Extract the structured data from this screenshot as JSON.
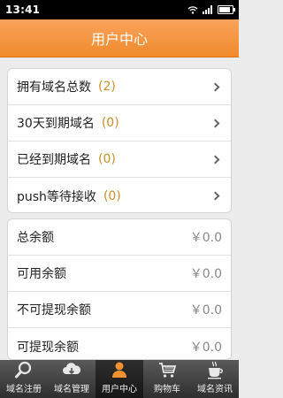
{
  "status": {
    "time": "13:41"
  },
  "header": {
    "title": "用户中心"
  },
  "domains": [
    {
      "label": "拥有域名总数",
      "count": "(2)"
    },
    {
      "label": "30天到期域名",
      "count": "(0)"
    },
    {
      "label": "已经到期域名",
      "count": "(0)"
    },
    {
      "label": "push等待接收",
      "count": "(0)"
    }
  ],
  "balances": [
    {
      "label": "总余额",
      "value": "￥0.0"
    },
    {
      "label": "可用余额",
      "value": "￥0.0"
    },
    {
      "label": "不可提现余额",
      "value": "￥0.0"
    },
    {
      "label": "可提现余额",
      "value": "￥0.0"
    }
  ],
  "tabs": [
    {
      "label": "域名注册",
      "icon": "search-icon"
    },
    {
      "label": "域名管理",
      "icon": "cloud-icon"
    },
    {
      "label": "用户中心",
      "icon": "user-icon"
    },
    {
      "label": "购物车",
      "icon": "cart-icon"
    },
    {
      "label": "域名资讯",
      "icon": "coffee-icon"
    }
  ],
  "colors": {
    "accent": "#f39131",
    "count": "#c9902b"
  }
}
